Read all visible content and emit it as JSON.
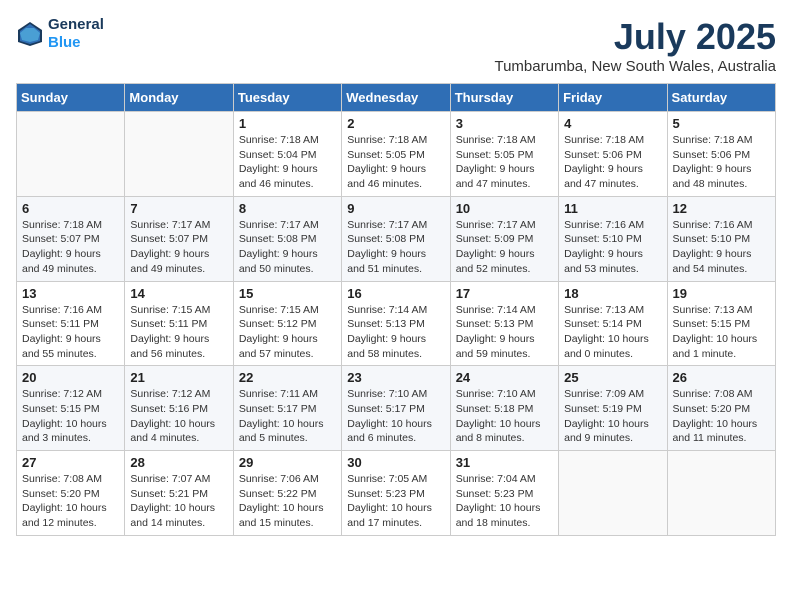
{
  "header": {
    "logo_line1": "General",
    "logo_line2": "Blue",
    "month": "July 2025",
    "location": "Tumbarumba, New South Wales, Australia"
  },
  "weekdays": [
    "Sunday",
    "Monday",
    "Tuesday",
    "Wednesday",
    "Thursday",
    "Friday",
    "Saturday"
  ],
  "weeks": [
    [
      {
        "day": "",
        "info": ""
      },
      {
        "day": "",
        "info": ""
      },
      {
        "day": "1",
        "info": "Sunrise: 7:18 AM\nSunset: 5:04 PM\nDaylight: 9 hours\nand 46 minutes."
      },
      {
        "day": "2",
        "info": "Sunrise: 7:18 AM\nSunset: 5:05 PM\nDaylight: 9 hours\nand 46 minutes."
      },
      {
        "day": "3",
        "info": "Sunrise: 7:18 AM\nSunset: 5:05 PM\nDaylight: 9 hours\nand 47 minutes."
      },
      {
        "day": "4",
        "info": "Sunrise: 7:18 AM\nSunset: 5:06 PM\nDaylight: 9 hours\nand 47 minutes."
      },
      {
        "day": "5",
        "info": "Sunrise: 7:18 AM\nSunset: 5:06 PM\nDaylight: 9 hours\nand 48 minutes."
      }
    ],
    [
      {
        "day": "6",
        "info": "Sunrise: 7:18 AM\nSunset: 5:07 PM\nDaylight: 9 hours\nand 49 minutes."
      },
      {
        "day": "7",
        "info": "Sunrise: 7:17 AM\nSunset: 5:07 PM\nDaylight: 9 hours\nand 49 minutes."
      },
      {
        "day": "8",
        "info": "Sunrise: 7:17 AM\nSunset: 5:08 PM\nDaylight: 9 hours\nand 50 minutes."
      },
      {
        "day": "9",
        "info": "Sunrise: 7:17 AM\nSunset: 5:08 PM\nDaylight: 9 hours\nand 51 minutes."
      },
      {
        "day": "10",
        "info": "Sunrise: 7:17 AM\nSunset: 5:09 PM\nDaylight: 9 hours\nand 52 minutes."
      },
      {
        "day": "11",
        "info": "Sunrise: 7:16 AM\nSunset: 5:10 PM\nDaylight: 9 hours\nand 53 minutes."
      },
      {
        "day": "12",
        "info": "Sunrise: 7:16 AM\nSunset: 5:10 PM\nDaylight: 9 hours\nand 54 minutes."
      }
    ],
    [
      {
        "day": "13",
        "info": "Sunrise: 7:16 AM\nSunset: 5:11 PM\nDaylight: 9 hours\nand 55 minutes."
      },
      {
        "day": "14",
        "info": "Sunrise: 7:15 AM\nSunset: 5:11 PM\nDaylight: 9 hours\nand 56 minutes."
      },
      {
        "day": "15",
        "info": "Sunrise: 7:15 AM\nSunset: 5:12 PM\nDaylight: 9 hours\nand 57 minutes."
      },
      {
        "day": "16",
        "info": "Sunrise: 7:14 AM\nSunset: 5:13 PM\nDaylight: 9 hours\nand 58 minutes."
      },
      {
        "day": "17",
        "info": "Sunrise: 7:14 AM\nSunset: 5:13 PM\nDaylight: 9 hours\nand 59 minutes."
      },
      {
        "day": "18",
        "info": "Sunrise: 7:13 AM\nSunset: 5:14 PM\nDaylight: 10 hours\nand 0 minutes."
      },
      {
        "day": "19",
        "info": "Sunrise: 7:13 AM\nSunset: 5:15 PM\nDaylight: 10 hours\nand 1 minute."
      }
    ],
    [
      {
        "day": "20",
        "info": "Sunrise: 7:12 AM\nSunset: 5:15 PM\nDaylight: 10 hours\nand 3 minutes."
      },
      {
        "day": "21",
        "info": "Sunrise: 7:12 AM\nSunset: 5:16 PM\nDaylight: 10 hours\nand 4 minutes."
      },
      {
        "day": "22",
        "info": "Sunrise: 7:11 AM\nSunset: 5:17 PM\nDaylight: 10 hours\nand 5 minutes."
      },
      {
        "day": "23",
        "info": "Sunrise: 7:10 AM\nSunset: 5:17 PM\nDaylight: 10 hours\nand 6 minutes."
      },
      {
        "day": "24",
        "info": "Sunrise: 7:10 AM\nSunset: 5:18 PM\nDaylight: 10 hours\nand 8 minutes."
      },
      {
        "day": "25",
        "info": "Sunrise: 7:09 AM\nSunset: 5:19 PM\nDaylight: 10 hours\nand 9 minutes."
      },
      {
        "day": "26",
        "info": "Sunrise: 7:08 AM\nSunset: 5:20 PM\nDaylight: 10 hours\nand 11 minutes."
      }
    ],
    [
      {
        "day": "27",
        "info": "Sunrise: 7:08 AM\nSunset: 5:20 PM\nDaylight: 10 hours\nand 12 minutes."
      },
      {
        "day": "28",
        "info": "Sunrise: 7:07 AM\nSunset: 5:21 PM\nDaylight: 10 hours\nand 14 minutes."
      },
      {
        "day": "29",
        "info": "Sunrise: 7:06 AM\nSunset: 5:22 PM\nDaylight: 10 hours\nand 15 minutes."
      },
      {
        "day": "30",
        "info": "Sunrise: 7:05 AM\nSunset: 5:23 PM\nDaylight: 10 hours\nand 17 minutes."
      },
      {
        "day": "31",
        "info": "Sunrise: 7:04 AM\nSunset: 5:23 PM\nDaylight: 10 hours\nand 18 minutes."
      },
      {
        "day": "",
        "info": ""
      },
      {
        "day": "",
        "info": ""
      }
    ]
  ]
}
